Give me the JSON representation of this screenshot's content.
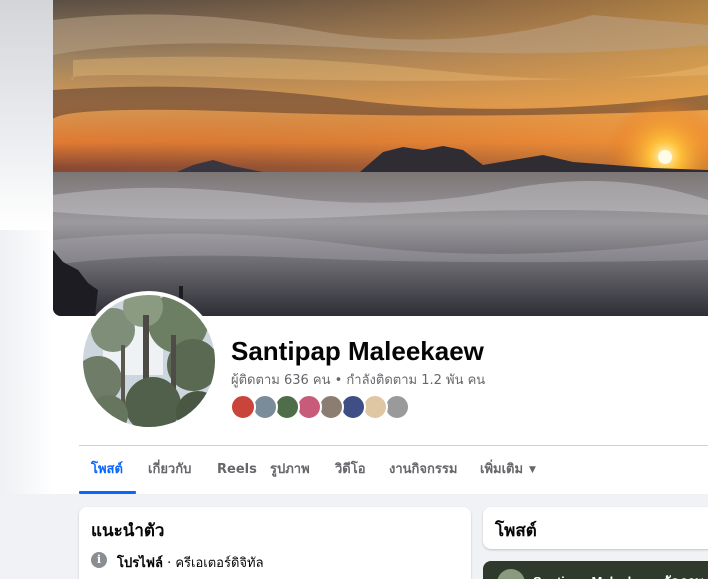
{
  "profile": {
    "name": "Santipap Maleekaew",
    "follow_stats": "ผู้ติดตาม 636 คน • กำลังติดตาม 1.2 พัน คน",
    "friend_avatar_colors": [
      "#c9453b",
      "#7a8c9a",
      "#4f6d48",
      "#c85a7a",
      "#8c7d72",
      "#3f4f86",
      "#e0c7a4",
      "#9a9a9a"
    ]
  },
  "tabs": [
    {
      "label": "โพสต์",
      "active": true
    },
    {
      "label": "เกี่ยวกับ",
      "active": false
    },
    {
      "label": "Reels",
      "active": false
    },
    {
      "label": "รูปภาพ",
      "active": false
    },
    {
      "label": "วิดีโอ",
      "active": false
    },
    {
      "label": "งานกิจกรรม",
      "active": false
    },
    {
      "label": "เพิ่มเติม",
      "active": false
    }
  ],
  "intro": {
    "title": "แนะนำตัว",
    "profile_label": "โปรไฟล์",
    "profile_type": " · ครีเอเตอร์ดิจิทัล"
  },
  "posts": {
    "title": "โพสต์",
    "preview_author": "Santipap Maleekaew อัดภาพ"
  },
  "colors": {
    "accent": "#0866ff",
    "secondary_text": "#65676b",
    "page_background": "#f0f2f5"
  }
}
